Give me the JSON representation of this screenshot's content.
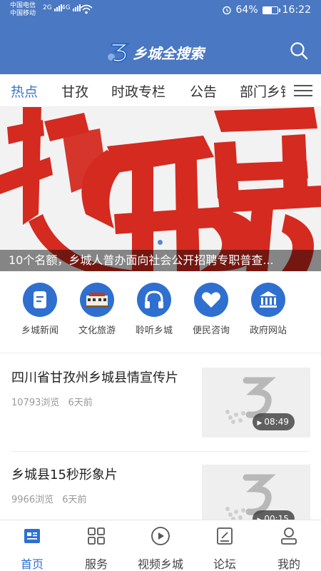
{
  "status_bar": {
    "carrier_1": "中国电信",
    "carrier_2": "中国移动",
    "net_1": "2G",
    "net_2": "4G",
    "battery": "64%",
    "time": "16:22"
  },
  "header": {
    "app_title": "乡城全搜索"
  },
  "tabs": [
    "热点",
    "甘孜",
    "时政专栏",
    "公告",
    "部门乡镇"
  ],
  "banner": {
    "caption": "10个名额，乡城人普办面向社会公开招聘专职普查..."
  },
  "quick_links": [
    {
      "label": "乡城新闻",
      "icon": "news-icon"
    },
    {
      "label": "文化旅游",
      "icon": "building-icon"
    },
    {
      "label": "聆听乡城",
      "icon": "headphones-icon"
    },
    {
      "label": "便民咨询",
      "icon": "heart-icon"
    },
    {
      "label": "政府网站",
      "icon": "government-icon"
    }
  ],
  "news": [
    {
      "title": "四川省甘孜州乡城县情宣传片",
      "views": "10793浏览",
      "time": "6天前",
      "duration": "08:49"
    },
    {
      "title": "乡城县15秒形象片",
      "views": "9966浏览",
      "time": "6天前",
      "duration": "00:15"
    }
  ],
  "bottom_nav": [
    {
      "label": "首页",
      "icon": "home-icon"
    },
    {
      "label": "服务",
      "icon": "grid-icon"
    },
    {
      "label": "视频乡城",
      "icon": "play-icon"
    },
    {
      "label": "论坛",
      "icon": "forum-icon"
    },
    {
      "label": "我的",
      "icon": "user-icon"
    }
  ],
  "colors": {
    "header": "#4a78c2",
    "accent": "#2f6fd0",
    "banner_red": "#d42a20"
  }
}
